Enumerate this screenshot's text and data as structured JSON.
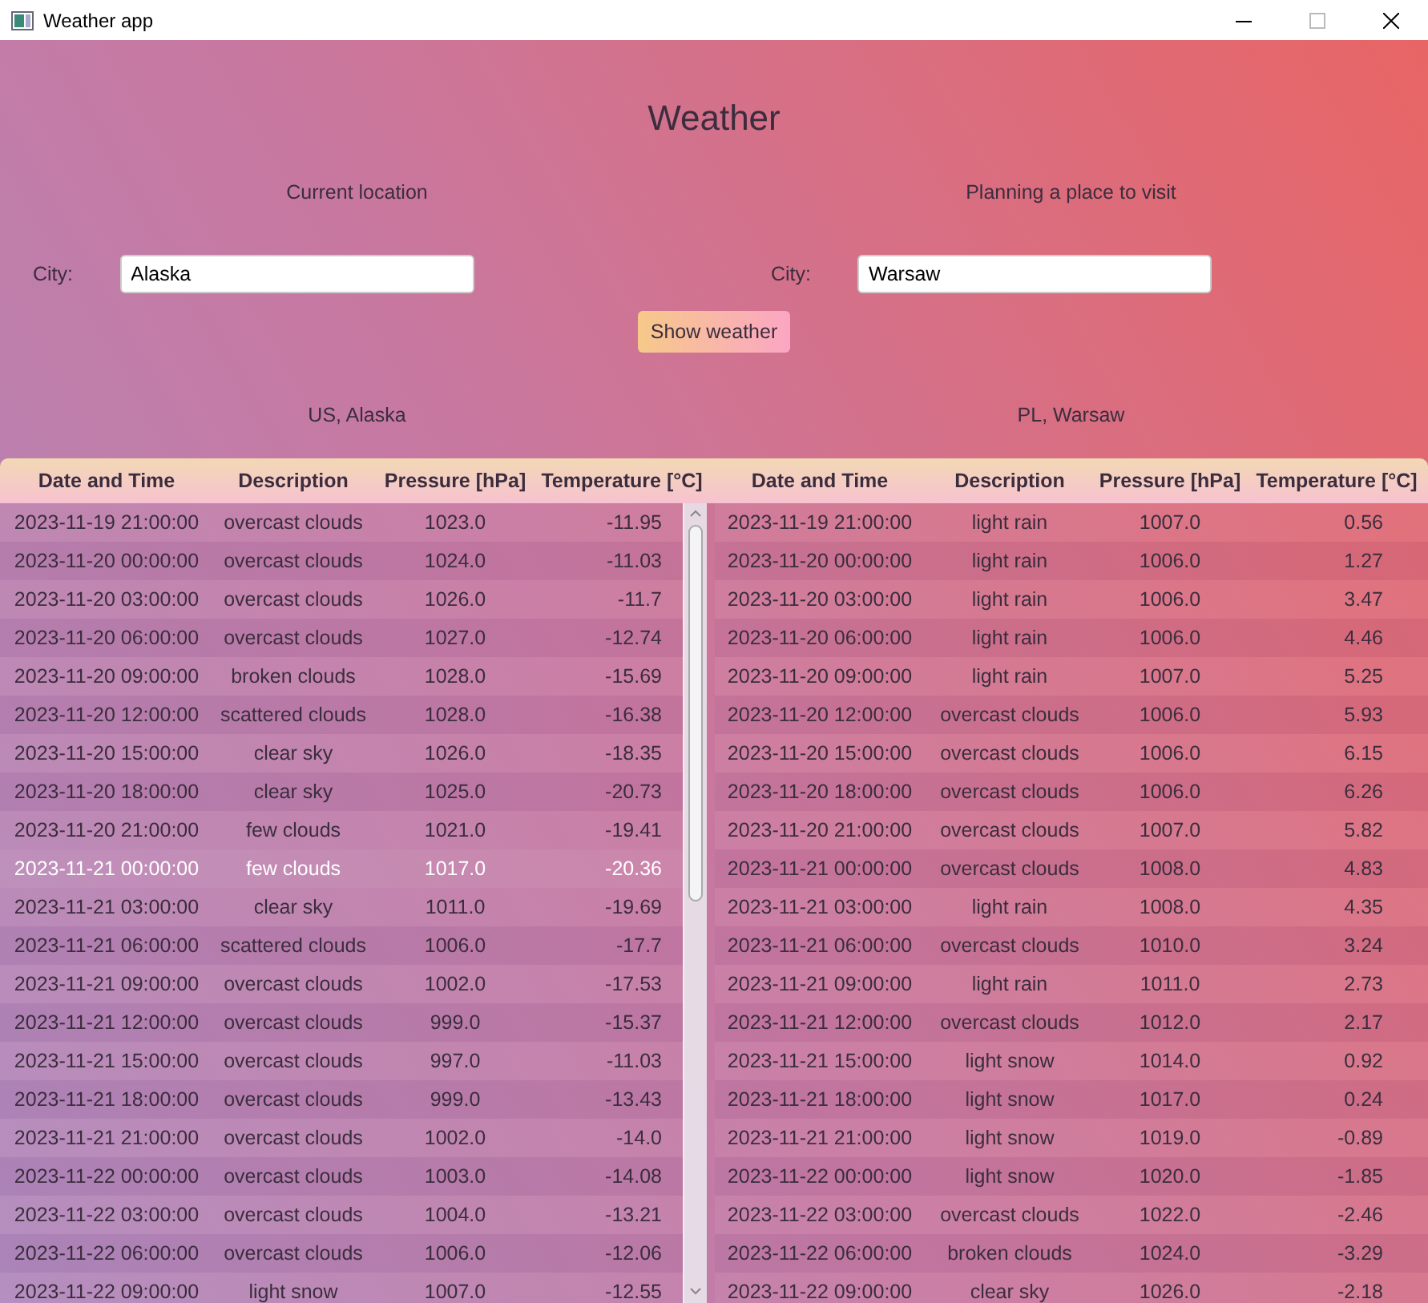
{
  "window": {
    "title": "Weather app"
  },
  "heading": "Weather",
  "locations": [
    {
      "section_label": "Current location",
      "city_label": "City:",
      "city_value": "Alaska",
      "result_label": "US, Alaska"
    },
    {
      "section_label": "Planning a place to visit",
      "city_label": "City:",
      "city_value": "Warsaw",
      "result_label": "PL, Warsaw"
    }
  ],
  "show_button": "Show weather",
  "tables": [
    {
      "columns": [
        "Date and Time",
        "Description",
        "Pressure [hPa]",
        "Temperature [°C]"
      ],
      "rows": [
        {
          "cells": [
            "2023-11-19 21:00:00",
            "overcast clouds",
            "1023.0",
            "-11.95"
          ],
          "selected": false
        },
        {
          "cells": [
            "2023-11-20 00:00:00",
            "overcast clouds",
            "1024.0",
            "-11.03"
          ],
          "selected": false
        },
        {
          "cells": [
            "2023-11-20 03:00:00",
            "overcast clouds",
            "1026.0",
            "-11.7"
          ],
          "selected": false
        },
        {
          "cells": [
            "2023-11-20 06:00:00",
            "overcast clouds",
            "1027.0",
            "-12.74"
          ],
          "selected": false
        },
        {
          "cells": [
            "2023-11-20 09:00:00",
            "broken clouds",
            "1028.0",
            "-15.69"
          ],
          "selected": false
        },
        {
          "cells": [
            "2023-11-20 12:00:00",
            "scattered clouds",
            "1028.0",
            "-16.38"
          ],
          "selected": false
        },
        {
          "cells": [
            "2023-11-20 15:00:00",
            "clear sky",
            "1026.0",
            "-18.35"
          ],
          "selected": false
        },
        {
          "cells": [
            "2023-11-20 18:00:00",
            "clear sky",
            "1025.0",
            "-20.73"
          ],
          "selected": false
        },
        {
          "cells": [
            "2023-11-20 21:00:00",
            "few clouds",
            "1021.0",
            "-19.41"
          ],
          "selected": false
        },
        {
          "cells": [
            "2023-11-21 00:00:00",
            "few clouds",
            "1017.0",
            "-20.36"
          ],
          "selected": true
        },
        {
          "cells": [
            "2023-11-21 03:00:00",
            "clear sky",
            "1011.0",
            "-19.69"
          ],
          "selected": false
        },
        {
          "cells": [
            "2023-11-21 06:00:00",
            "scattered clouds",
            "1006.0",
            "-17.7"
          ],
          "selected": false
        },
        {
          "cells": [
            "2023-11-21 09:00:00",
            "overcast clouds",
            "1002.0",
            "-17.53"
          ],
          "selected": false
        },
        {
          "cells": [
            "2023-11-21 12:00:00",
            "overcast clouds",
            "999.0",
            "-15.37"
          ],
          "selected": false
        },
        {
          "cells": [
            "2023-11-21 15:00:00",
            "overcast clouds",
            "997.0",
            "-11.03"
          ],
          "selected": false
        },
        {
          "cells": [
            "2023-11-21 18:00:00",
            "overcast clouds",
            "999.0",
            "-13.43"
          ],
          "selected": false
        },
        {
          "cells": [
            "2023-11-21 21:00:00",
            "overcast clouds",
            "1002.0",
            "-14.0"
          ],
          "selected": false
        },
        {
          "cells": [
            "2023-11-22 00:00:00",
            "overcast clouds",
            "1003.0",
            "-14.08"
          ],
          "selected": false
        },
        {
          "cells": [
            "2023-11-22 03:00:00",
            "overcast clouds",
            "1004.0",
            "-13.21"
          ],
          "selected": false
        },
        {
          "cells": [
            "2023-11-22 06:00:00",
            "overcast clouds",
            "1006.0",
            "-12.06"
          ],
          "selected": false
        },
        {
          "cells": [
            "2023-11-22 09:00:00",
            "light snow",
            "1007.0",
            "-12.55"
          ],
          "selected": false
        }
      ]
    },
    {
      "columns": [
        "Date and Time",
        "Description",
        "Pressure [hPa]",
        "Temperature [°C]"
      ],
      "rows": [
        {
          "cells": [
            "2023-11-19 21:00:00",
            "light rain",
            "1007.0",
            "0.56"
          ],
          "selected": false
        },
        {
          "cells": [
            "2023-11-20 00:00:00",
            "light rain",
            "1006.0",
            "1.27"
          ],
          "selected": false
        },
        {
          "cells": [
            "2023-11-20 03:00:00",
            "light rain",
            "1006.0",
            "3.47"
          ],
          "selected": false
        },
        {
          "cells": [
            "2023-11-20 06:00:00",
            "light rain",
            "1006.0",
            "4.46"
          ],
          "selected": false
        },
        {
          "cells": [
            "2023-11-20 09:00:00",
            "light rain",
            "1007.0",
            "5.25"
          ],
          "selected": false
        },
        {
          "cells": [
            "2023-11-20 12:00:00",
            "overcast clouds",
            "1006.0",
            "5.93"
          ],
          "selected": false
        },
        {
          "cells": [
            "2023-11-20 15:00:00",
            "overcast clouds",
            "1006.0",
            "6.15"
          ],
          "selected": false
        },
        {
          "cells": [
            "2023-11-20 18:00:00",
            "overcast clouds",
            "1006.0",
            "6.26"
          ],
          "selected": false
        },
        {
          "cells": [
            "2023-11-20 21:00:00",
            "overcast clouds",
            "1007.0",
            "5.82"
          ],
          "selected": false
        },
        {
          "cells": [
            "2023-11-21 00:00:00",
            "overcast clouds",
            "1008.0",
            "4.83"
          ],
          "selected": false
        },
        {
          "cells": [
            "2023-11-21 03:00:00",
            "light rain",
            "1008.0",
            "4.35"
          ],
          "selected": false
        },
        {
          "cells": [
            "2023-11-21 06:00:00",
            "overcast clouds",
            "1010.0",
            "3.24"
          ],
          "selected": false
        },
        {
          "cells": [
            "2023-11-21 09:00:00",
            "light rain",
            "1011.0",
            "2.73"
          ],
          "selected": false
        },
        {
          "cells": [
            "2023-11-21 12:00:00",
            "overcast clouds",
            "1012.0",
            "2.17"
          ],
          "selected": false
        },
        {
          "cells": [
            "2023-11-21 15:00:00",
            "light snow",
            "1014.0",
            "0.92"
          ],
          "selected": false
        },
        {
          "cells": [
            "2023-11-21 18:00:00",
            "light snow",
            "1017.0",
            "0.24"
          ],
          "selected": false
        },
        {
          "cells": [
            "2023-11-21 21:00:00",
            "light snow",
            "1019.0",
            "-0.89"
          ],
          "selected": false
        },
        {
          "cells": [
            "2023-11-22 00:00:00",
            "light snow",
            "1020.0",
            "-1.85"
          ],
          "selected": false
        },
        {
          "cells": [
            "2023-11-22 03:00:00",
            "overcast clouds",
            "1022.0",
            "-2.46"
          ],
          "selected": false
        },
        {
          "cells": [
            "2023-11-22 06:00:00",
            "broken clouds",
            "1024.0",
            "-3.29"
          ],
          "selected": false
        },
        {
          "cells": [
            "2023-11-22 09:00:00",
            "clear sky",
            "1026.0",
            "-2.18"
          ],
          "selected": false
        }
      ]
    }
  ]
}
